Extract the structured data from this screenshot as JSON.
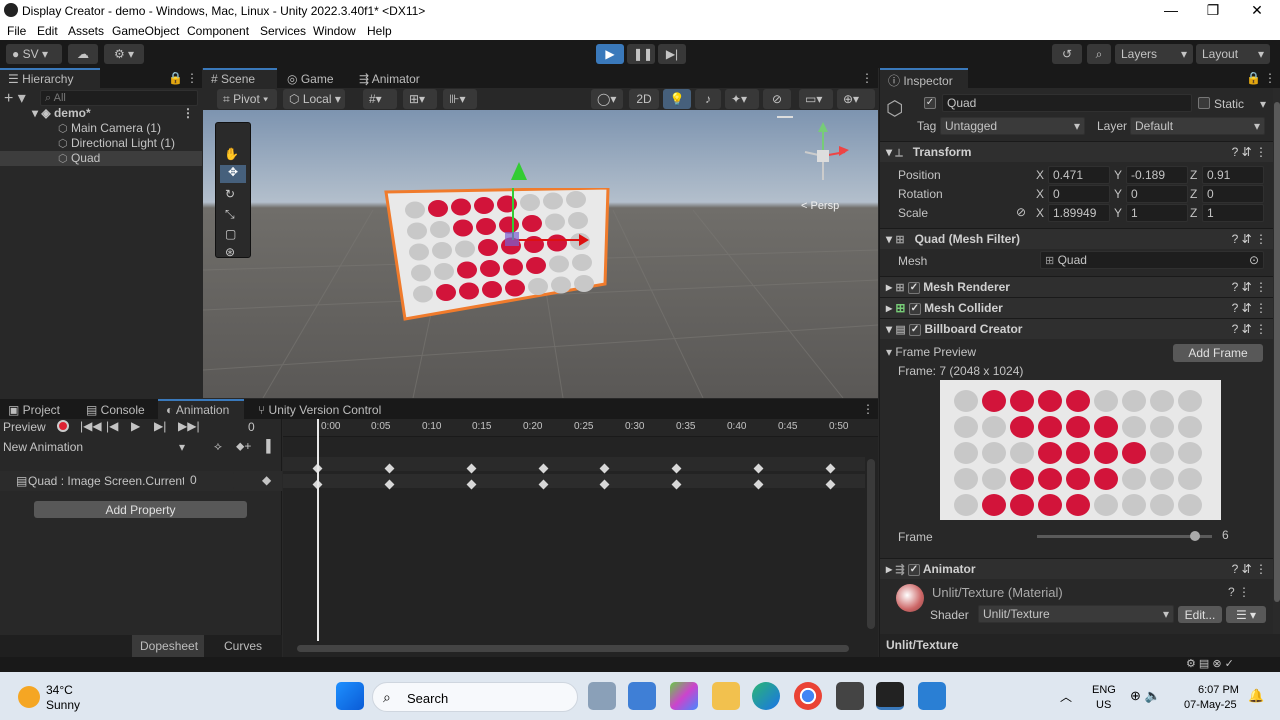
{
  "window": {
    "title": "Display Creator - demo - Windows, Mac, Linux - Unity 2022.3.40f1* <DX11>",
    "minimize": "—",
    "maximize": "❐",
    "close": "✕"
  },
  "menu": [
    "File",
    "Edit",
    "Assets",
    "GameObject",
    "Component",
    "Services",
    "Window",
    "Help"
  ],
  "toolbar": {
    "account": "SV",
    "layers": "Layers",
    "layout": "Layout"
  },
  "hierarchy": {
    "tab": "Hierarchy",
    "search_placeholder": "All",
    "scene": "demo*",
    "items": [
      "Main Camera (1)",
      "Directional Light (1)",
      "Quad"
    ]
  },
  "scene_tabs": [
    "Scene",
    "Game",
    "Animator"
  ],
  "scene_toolbar": {
    "pivot": "Pivot",
    "local": "Local",
    "mode2d": "2D",
    "persp": "< Persp"
  },
  "bottom_tabs": [
    "Project",
    "Console",
    "Animation",
    "Unity Version Control"
  ],
  "animation": {
    "preview": "Preview",
    "frame": "0",
    "clip": "New Animation",
    "property": "Quad : Image Screen.Current I",
    "property_value": "0",
    "add_property": "Add Property",
    "dopesheet": "Dopesheet",
    "curves": "Curves",
    "ticks": [
      "0:00",
      "0:05",
      "0:10",
      "0:15",
      "0:20",
      "0:25",
      "0:30",
      "0:35",
      "0:40",
      "0:45",
      "0:50"
    ],
    "keyframes": [
      0,
      0.14,
      0.3,
      0.44,
      0.56,
      0.7,
      0.86,
      1.0
    ]
  },
  "inspector": {
    "tab": "Inspector",
    "name": "Quad",
    "static": "Static",
    "tag_label": "Tag",
    "tag": "Untagged",
    "layer_label": "Layer",
    "layer": "Default",
    "transform": {
      "title": "Transform",
      "position_label": "Position",
      "rotation_label": "Rotation",
      "scale_label": "Scale",
      "position": [
        "0.471",
        "-0.189",
        "0.91"
      ],
      "rotation": [
        "0",
        "0",
        "0"
      ],
      "scale": [
        "1.89949",
        "1",
        "1"
      ],
      "axes": [
        "X",
        "Y",
        "Z"
      ]
    },
    "mesh_filter": {
      "title": "Quad (Mesh Filter)",
      "mesh_label": "Mesh",
      "mesh": "Quad"
    },
    "mesh_renderer": "Mesh Renderer",
    "mesh_collider": "Mesh Collider",
    "billboard": "Billboard Creator",
    "frame_preview": "Frame Preview",
    "add_frame": "Add Frame",
    "frame_info": "Frame: 7 (2048 x 1024)",
    "frame_label": "Frame",
    "frame_value": "6",
    "frame_fraction": 0.9,
    "animator": "Animator",
    "material": "Unlit/Texture (Material)",
    "shader_label": "Shader",
    "shader": "Unlit/Texture",
    "edit": "Edit...",
    "footer": "Unlit/Texture"
  },
  "preview_grid": [
    [
      0,
      1,
      1,
      1,
      1,
      0,
      0,
      0,
      0
    ],
    [
      0,
      0,
      1,
      1,
      1,
      1,
      0,
      0,
      0
    ],
    [
      0,
      0,
      0,
      1,
      1,
      1,
      1,
      0,
      0
    ],
    [
      0,
      0,
      1,
      1,
      1,
      1,
      0,
      0,
      0
    ],
    [
      0,
      1,
      1,
      1,
      1,
      0,
      0,
      0,
      0
    ]
  ],
  "scene_grid": [
    [
      0,
      1,
      1,
      1,
      1,
      0,
      0,
      0
    ],
    [
      0,
      0,
      1,
      1,
      1,
      1,
      0,
      0
    ],
    [
      0,
      0,
      0,
      1,
      1,
      1,
      1,
      0
    ],
    [
      0,
      0,
      1,
      1,
      1,
      1,
      0,
      0
    ],
    [
      0,
      1,
      1,
      1,
      1,
      0,
      0,
      0
    ]
  ],
  "colors": {
    "red": "#d2143a",
    "grey": "#c8c8c8",
    "accent": "#3a79bb"
  },
  "taskbar": {
    "temp": "34°C",
    "weather": "Sunny",
    "search": "Search",
    "lang1": "ENG",
    "lang2": "US",
    "time": "6:07 PM",
    "date": "07-May-25"
  }
}
